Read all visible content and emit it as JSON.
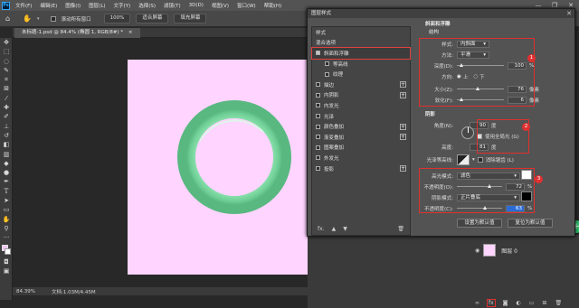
{
  "app": {
    "logo": "Ps"
  },
  "menu": [
    "文件(F)",
    "编辑(E)",
    "图像(I)",
    "图层(L)",
    "文字(Y)",
    "选择(S)",
    "滤镜(T)",
    "3D(D)",
    "视图(V)",
    "窗口(W)",
    "帮助(H)"
  ],
  "window_controls": {
    "minimize": "—",
    "maximize": "❐",
    "close": "✕"
  },
  "options": {
    "scroll_all": "滚动所有窗口",
    "zoom": "100%",
    "fit_screen": "适合屏幕",
    "fill_screen": "填充屏幕"
  },
  "document": {
    "tab": "未标题-1.psd @ 84.4% (椭圆 1, RGB/8#) *",
    "close": "×"
  },
  "status": {
    "zoom": "84.39%",
    "doc": "文档:1.03M/4.45M"
  },
  "dialog": {
    "title": "图层样式",
    "styles": [
      {
        "label": "样式",
        "check": false,
        "plus": false,
        "indent": 0
      },
      {
        "label": "混合选项",
        "check": false,
        "plus": false,
        "indent": 0
      },
      {
        "label": "斜面和浮雕",
        "check": true,
        "checked": true,
        "plus": false,
        "indent": 0,
        "selected": true
      },
      {
        "label": "等高线",
        "check": true,
        "checked": false,
        "plus": false,
        "indent": 1
      },
      {
        "label": "纹理",
        "check": true,
        "checked": false,
        "plus": false,
        "indent": 1
      },
      {
        "label": "描边",
        "check": true,
        "checked": false,
        "plus": true,
        "indent": 0
      },
      {
        "label": "内阴影",
        "check": true,
        "checked": false,
        "plus": true,
        "indent": 0
      },
      {
        "label": "内发光",
        "check": true,
        "checked": false,
        "plus": false,
        "indent": 0
      },
      {
        "label": "光泽",
        "check": true,
        "checked": false,
        "plus": false,
        "indent": 0
      },
      {
        "label": "颜色叠加",
        "check": true,
        "checked": false,
        "plus": true,
        "indent": 0
      },
      {
        "label": "渐变叠加",
        "check": true,
        "checked": false,
        "plus": true,
        "indent": 0
      },
      {
        "label": "图案叠加",
        "check": true,
        "checked": false,
        "plus": false,
        "indent": 0
      },
      {
        "label": "外发光",
        "check": true,
        "checked": false,
        "plus": false,
        "indent": 0
      },
      {
        "label": "投影",
        "check": true,
        "checked": false,
        "plus": true,
        "indent": 0
      }
    ],
    "footer": {
      "fx": "fx.",
      "up": "▲",
      "down": "▼",
      "trash": "🗑"
    },
    "bevel": {
      "heading": "斜面和浮雕",
      "structure": "结构",
      "style_label": "样式:",
      "style_value": "内斜面",
      "technique_label": "方法:",
      "technique_value": "平滑",
      "depth_label": "深度(D):",
      "depth_value": "100",
      "depth_unit": "%",
      "depth_level": 0.1,
      "direction_label": "方向:",
      "dir_up": "上",
      "dir_down": "下",
      "size_label": "大小(Z):",
      "size_value": "76",
      "size_unit": "像素",
      "size_level": 0.45,
      "soften_label": "软化(F):",
      "soften_value": "6",
      "soften_unit": "像素",
      "soften_level": 0.1
    },
    "shading": {
      "heading": "阴影",
      "angle_label": "角度(N):",
      "angle_value": "90",
      "angle_unit": "度",
      "global_light": "使用全局光 (G)",
      "altitude_label": "高度:",
      "altitude_value": "81",
      "altitude_unit": "度",
      "gloss_label": "光泽等高线:",
      "antialias": "消除锯齿 (L)",
      "highlight_label": "高光模式:",
      "highlight_value": "滤色",
      "hl_opacity_label": "不透明度(O):",
      "hl_opacity_value": "72",
      "hl_opacity_unit": "%",
      "hl_opacity_level": 0.72,
      "shadow_label": "阴影模式:",
      "shadow_value": "正片叠底",
      "sh_opacity_label": "不透明度(C):",
      "sh_opacity_value": "63",
      "sh_opacity_unit": "%",
      "sh_opacity_level": 0.63
    },
    "buttons": {
      "make_default": "设置为默认值",
      "reset_default": "复位为默认值"
    },
    "badges": [
      "1",
      "2",
      "3"
    ]
  },
  "layers": {
    "layer_name": "图层 0"
  },
  "colors": {
    "canvas": "#ffd4ff",
    "ring": "#7ed8a0",
    "ring_dark": "#5cbf86",
    "highlight_swatch": "#ffffff",
    "shadow_swatch": "#000000",
    "accent_red": "#e03030"
  }
}
